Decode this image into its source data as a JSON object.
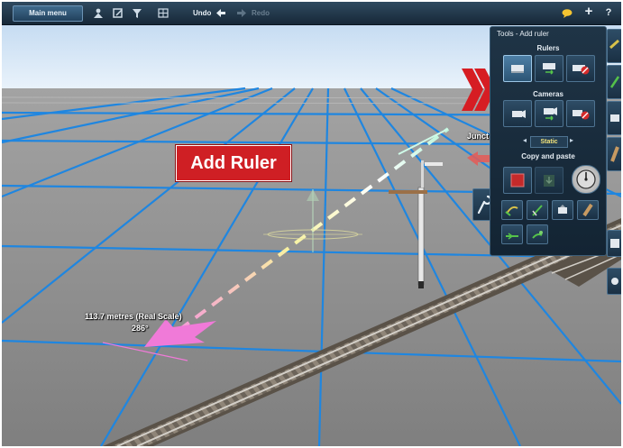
{
  "toolbar": {
    "main_menu_label": "Main menu",
    "undo_label": "Undo",
    "redo_label": "Redo",
    "icons": [
      "person-icon",
      "edit-icon",
      "filter-icon",
      "grid-icon",
      "undo-icon",
      "redo-icon",
      "chat-icon",
      "plus-icon",
      "help-icon"
    ],
    "plus_symbol": "+",
    "help_symbol": "?"
  },
  "viewport": {
    "measurement_label": "113.7 metres (Real Scale)",
    "angle_label": "286°",
    "junction_label": "Junct",
    "callout_text": "Add Ruler"
  },
  "tools_panel": {
    "title": "Tools - Add ruler",
    "rulers_label": "Rulers",
    "cameras_label": "Cameras",
    "camera_mode": "Static",
    "copy_paste_label": "Copy and paste",
    "arrow_left": "◂",
    "arrow_right": "▸"
  },
  "colors": {
    "toolbar_bg": "#172838",
    "callout_red": "#cf1f24",
    "grid_blue": "#1f86e0",
    "ruler_pink": "#f07ad8"
  }
}
